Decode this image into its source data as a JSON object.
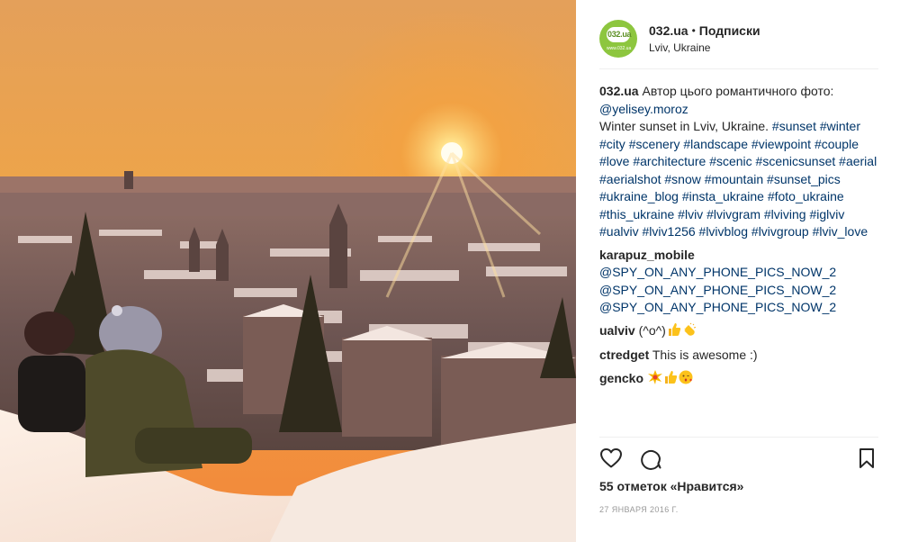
{
  "post": {
    "account": "032.ua",
    "separator": "•",
    "follow_label": "Подписки",
    "location": "Lviv, Ukraine",
    "avatar": {
      "bubble_text": "032.ua",
      "site_text": "www.032.ua",
      "color": "#8dc63f"
    }
  },
  "caption": {
    "author": "032.ua",
    "text": "Автор цього романтичного фото:",
    "mention": "@yelisey.moroz",
    "body": "Winter sunset in Lviv, Ukraine.",
    "hashtags": [
      "#sunset",
      "#winter",
      "#city",
      "#scenery",
      "#landscape",
      "#viewpoint",
      "#couple",
      "#love",
      "#architecture",
      "#scenic",
      "#scenicsunset",
      "#aerial",
      "#aerialshot",
      "#snow",
      "#mountain",
      "#sunset_pics",
      "#ukraine_blog",
      "#insta_ukraine",
      "#foto_ukraine",
      "#this_ukraine",
      "#lviv",
      "#lvivgram",
      "#lviving",
      "#iglviv",
      "#ualviv",
      "#lviv1256",
      "#lvivblog",
      "#lvivgroup",
      "#lviv_love"
    ]
  },
  "comments": [
    {
      "user": "karapuz_mobile",
      "text": "",
      "mentions": [
        "@SPY_ON_ANY_PHONE_PICS_NOW_2",
        "@SPY_ON_ANY_PHONE_PICS_NOW_2",
        "@SPY_ON_ANY_PHONE_PICS_NOW_2"
      ],
      "emoji": []
    },
    {
      "user": "ualviv",
      "text": "(^o^)",
      "mentions": [],
      "emoji": [
        "thumbs-up-emoji",
        "clapping-hands-emoji"
      ]
    },
    {
      "user": "ctredget",
      "text": "This is awesome :)",
      "mentions": [],
      "emoji": []
    },
    {
      "user": "gencko",
      "text": "",
      "mentions": [],
      "emoji": [
        "sparkle-emoji",
        "thumbs-up-emoji",
        "kiss-emoji"
      ]
    }
  ],
  "likes": "55 отметок «Нравится»",
  "date": "27 января 2016 г.",
  "icons": {
    "like": "heart-outline-icon",
    "comment": "speech-bubble-icon",
    "save": "bookmark-icon"
  },
  "colors": {
    "link": "#003569",
    "text": "#262626",
    "muted": "#999999",
    "divider": "#efefef"
  }
}
